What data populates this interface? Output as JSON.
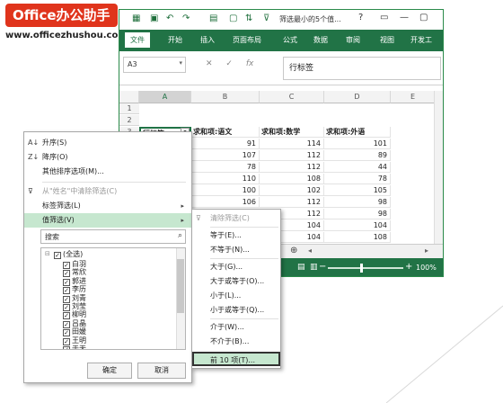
{
  "logo": {
    "title": "Office办公助手",
    "url": "www.officezhushou.com"
  },
  "window": {
    "title": "筛选最小的5个值...",
    "help": "?",
    "controls": [
      "▭",
      "—",
      "▢"
    ]
  },
  "ribbon": {
    "tabs": [
      "文件",
      "开始",
      "插入",
      "页面布局",
      "公式",
      "数据",
      "审阅",
      "视图",
      "开发工"
    ]
  },
  "formula_bar": {
    "name_box": "A3",
    "cancel": "✕",
    "confirm": "✓",
    "fx": "fx",
    "value": "行标签"
  },
  "columns": [
    "A",
    "B",
    "C",
    "D",
    "E"
  ],
  "rows": [
    "1",
    "2",
    "3",
    "4",
    "5",
    "6",
    "7",
    "8",
    "9",
    "10",
    "11",
    "12",
    "13"
  ],
  "table": {
    "headers": [
      "行标签",
      "求和项:语文",
      "求和项:数学",
      "求和项:外语"
    ],
    "data": [
      [
        "",
        "91",
        "114",
        "101"
      ],
      [
        "",
        "107",
        "112",
        "89"
      ],
      [
        "",
        "78",
        "112",
        "44"
      ],
      [
        "",
        "110",
        "108",
        "78"
      ],
      [
        "",
        "100",
        "102",
        "105"
      ],
      [
        "",
        "106",
        "112",
        "98"
      ],
      [
        "",
        "106",
        "112",
        "98"
      ],
      [
        "",
        "106",
        "104",
        "104"
      ],
      [
        "",
        "106",
        "104",
        "108"
      ],
      [
        "",
        "106",
        "116",
        "100"
      ]
    ]
  },
  "statusbar": {
    "zoom": "100%",
    "minus": "−",
    "plus": "+"
  },
  "filter_menu": {
    "sort_asc": "升序(S)",
    "sort_desc": "降序(O)",
    "more_sort": "其他排序选项(M)...",
    "clear_filter": "从\"姓名\"中清除筛选(C)",
    "label_filter": "标签筛选(L)",
    "value_filter": "值筛选(V)",
    "search_placeholder": "搜索",
    "items": [
      "(全选)",
      "白羽",
      "常欣",
      "郭进",
      "李历",
      "刘青",
      "刘莹",
      "柳明",
      "吕晶",
      "田媛",
      "王明",
      "于天"
    ],
    "ok": "确定",
    "cancel": "取消"
  },
  "value_submenu": {
    "items": [
      "清除筛选(C)",
      "等于(E)...",
      "不等于(N)...",
      "大于(G)...",
      "大于或等于(O)...",
      "小于(L)...",
      "小于或等于(Q)...",
      "介于(W)...",
      "不介于(B)...",
      "前 10 项(T)..."
    ]
  },
  "colors": {
    "excel_green": "#217346",
    "highlight": "#c6e7cf",
    "logo_red": "#e0341c"
  }
}
